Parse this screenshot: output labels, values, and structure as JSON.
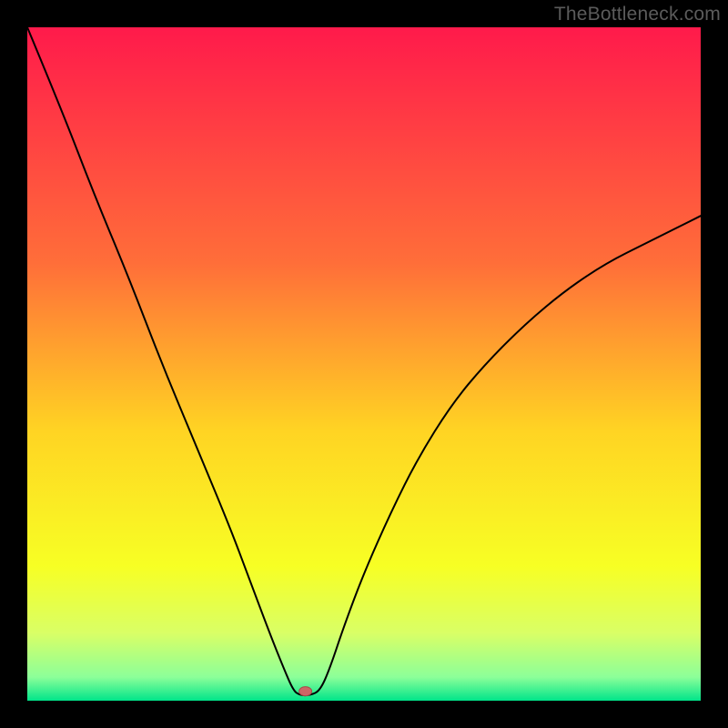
{
  "watermark": {
    "text": "TheBottleneck.com"
  },
  "chart_data": {
    "type": "line",
    "title": "",
    "xlabel": "",
    "ylabel": "",
    "xlim": [
      0,
      100
    ],
    "ylim": [
      0,
      100
    ],
    "background_gradient": [
      {
        "pos": 0.0,
        "color": "#ff1a4b"
      },
      {
        "pos": 0.35,
        "color": "#ff6e39"
      },
      {
        "pos": 0.6,
        "color": "#ffd423"
      },
      {
        "pos": 0.8,
        "color": "#f7ff24"
      },
      {
        "pos": 0.9,
        "color": "#d9ff66"
      },
      {
        "pos": 0.965,
        "color": "#8cff99"
      },
      {
        "pos": 1.0,
        "color": "#00e58a"
      }
    ],
    "curve": {
      "stroke": "#000000",
      "stroke_width": 2,
      "series": [
        {
          "x": 0,
          "y": 100
        },
        {
          "x": 5,
          "y": 88
        },
        {
          "x": 10,
          "y": 75
        },
        {
          "x": 15,
          "y": 63
        },
        {
          "x": 20,
          "y": 50
        },
        {
          "x": 25,
          "y": 38
        },
        {
          "x": 30,
          "y": 26
        },
        {
          "x": 33,
          "y": 18
        },
        {
          "x": 36,
          "y": 10
        },
        {
          "x": 38,
          "y": 5
        },
        {
          "x": 39.5,
          "y": 1.5
        },
        {
          "x": 40.5,
          "y": 0.8
        },
        {
          "x": 42,
          "y": 0.8
        },
        {
          "x": 43.5,
          "y": 1.5
        },
        {
          "x": 45,
          "y": 5
        },
        {
          "x": 47,
          "y": 11
        },
        {
          "x": 50,
          "y": 19
        },
        {
          "x": 54,
          "y": 28
        },
        {
          "x": 58,
          "y": 36
        },
        {
          "x": 63,
          "y": 44
        },
        {
          "x": 68,
          "y": 50
        },
        {
          "x": 74,
          "y": 56
        },
        {
          "x": 80,
          "y": 61
        },
        {
          "x": 86,
          "y": 65
        },
        {
          "x": 92,
          "y": 68
        },
        {
          "x": 100,
          "y": 72
        }
      ]
    },
    "marker": {
      "x": 41.3,
      "y": 1.4,
      "rx": 7,
      "ry": 5,
      "fill": "#cc6666",
      "stroke": "#a84a4a"
    }
  }
}
